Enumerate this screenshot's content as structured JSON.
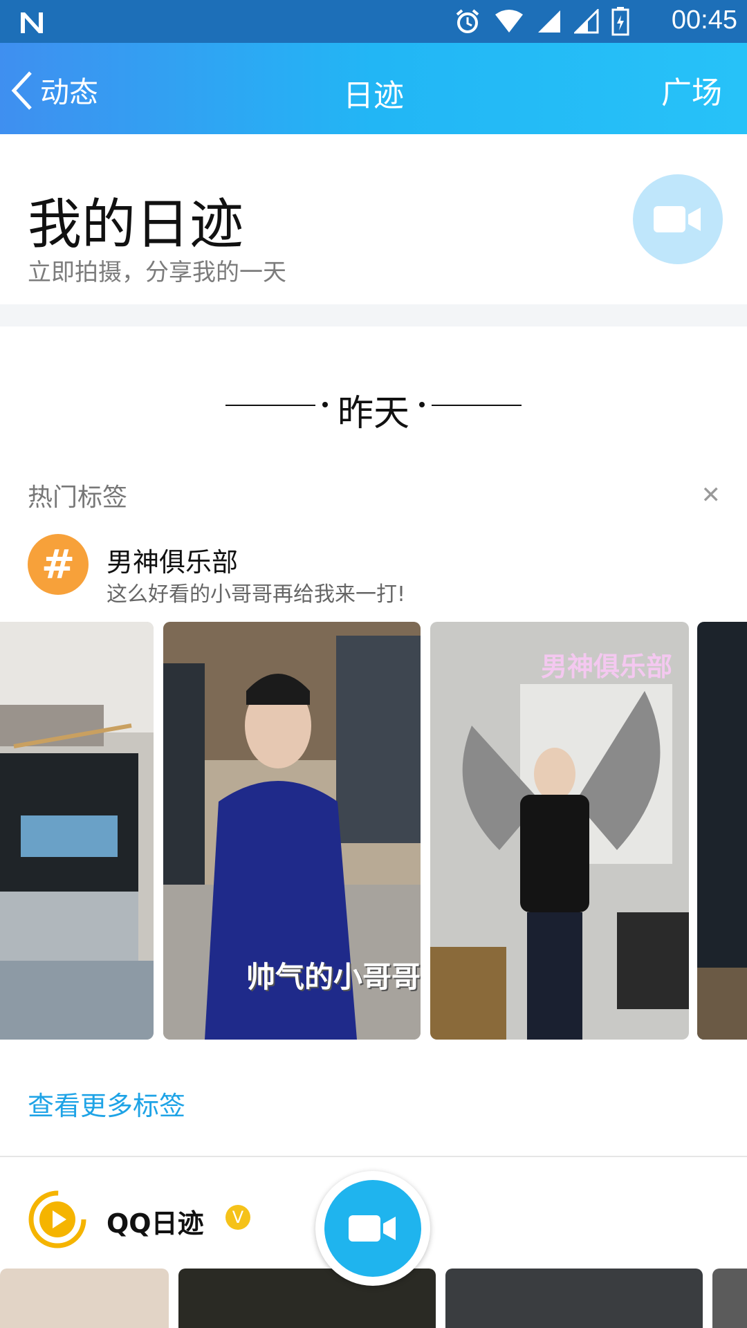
{
  "status_bar": {
    "time": "00:45"
  },
  "header": {
    "back_label": "动态",
    "title": "日迹",
    "right_label": "广场"
  },
  "my_diary": {
    "title": "我的日迹",
    "subtitle": "立即拍摄，分享我的一天"
  },
  "divider": {
    "label": "昨天"
  },
  "hot_tags": {
    "heading": "热门标签",
    "tag": {
      "icon": "#",
      "name": "男神俱乐部",
      "description": "这么好看的小哥哥再给我来一打!"
    },
    "thumbnails": [
      {
        "caption": ""
      },
      {
        "caption": "帅气的小哥哥"
      },
      {
        "caption": "男神俱乐部"
      },
      {
        "caption": ""
      }
    ],
    "more_link": "查看更多标签"
  },
  "qq_diary": {
    "name": "QQ日迹",
    "badge": "V"
  },
  "colors": {
    "accent": "#1fb4ee",
    "tag_orange": "#f7a13a",
    "link": "#1ea3e6",
    "qq_yellow": "#f5b400"
  }
}
